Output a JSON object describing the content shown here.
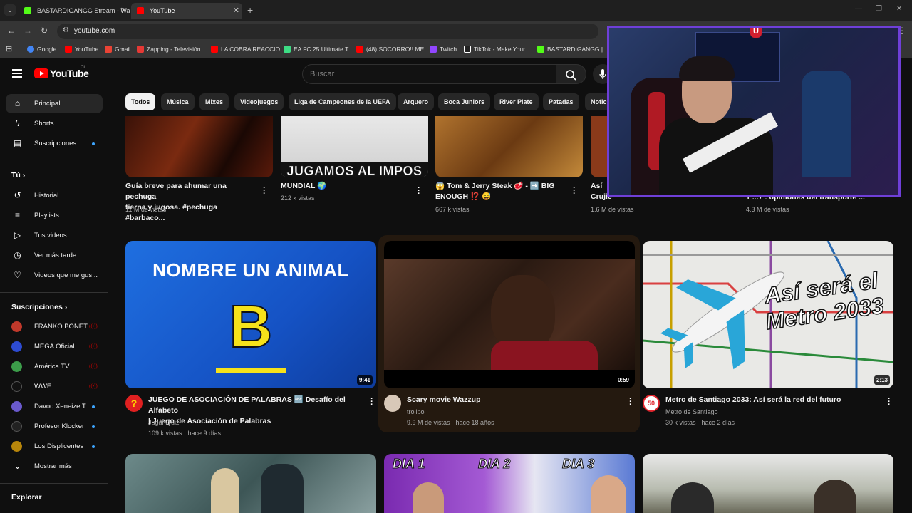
{
  "browser": {
    "tabs": [
      {
        "title": "BASTARDIGANGG Stream - Wa",
        "active": false,
        "favicon_color": "#53fc18"
      },
      {
        "title": "YouTube",
        "active": true,
        "favicon_color": "#ff0000"
      }
    ],
    "url": "youtube.com",
    "bookmarks": [
      {
        "label": "Google",
        "color": "#4285f4"
      },
      {
        "label": "YouTube",
        "color": "#ff0000"
      },
      {
        "label": "Gmail",
        "color": "#ea4335"
      },
      {
        "label": "Zapping - Televisión...",
        "color": "#e53935"
      },
      {
        "label": "LA COBRA REACCIO...",
        "color": "#ff0000"
      },
      {
        "label": "EA FC 25 Ultimate T...",
        "color": "#3ddc84"
      },
      {
        "label": "(48) SOCORRO!! ME...",
        "color": "#ff0000"
      },
      {
        "label": "Twitch",
        "color": "#9146ff"
      },
      {
        "label": "TikTok - Make Your...",
        "color": "#ffffff"
      },
      {
        "label": "BASTARDIGANGG |...",
        "color": "#53fc18"
      }
    ]
  },
  "header": {
    "logo_text": "YouTube",
    "country": "CL",
    "search_placeholder": "Buscar"
  },
  "sidebar": {
    "main": [
      {
        "label": "Principal",
        "icon": "home-icon",
        "glyph": "⌂",
        "active": true
      },
      {
        "label": "Shorts",
        "icon": "shorts-icon",
        "glyph": "ϟ"
      },
      {
        "label": "Suscripciones",
        "icon": "subscriptions-icon",
        "glyph": "▤",
        "dot": true
      }
    ],
    "you_header": "Tú",
    "you": [
      {
        "label": "Historial",
        "icon": "history-icon",
        "glyph": "↺"
      },
      {
        "label": "Playlists",
        "icon": "playlists-icon",
        "glyph": "≡"
      },
      {
        "label": "Tus videos",
        "icon": "your-videos-icon",
        "glyph": "▷"
      },
      {
        "label": "Ver más tarde",
        "icon": "watch-later-icon",
        "glyph": "◷"
      },
      {
        "label": "Videos que me gus...",
        "icon": "liked-icon",
        "glyph": "♡"
      }
    ],
    "subs_header": "Suscripciones",
    "subs": [
      {
        "label": "FRANKO BONET...",
        "color": "#c0392b",
        "live": true
      },
      {
        "label": "MEGA Oficial",
        "color": "#2d4bd1",
        "live": true
      },
      {
        "label": "América TV",
        "color": "#3c9d4a",
        "live": true
      },
      {
        "label": "WWE",
        "color": "#111111",
        "live": true
      },
      {
        "label": "Davoo Xeneize T...",
        "color": "#6a5acd",
        "dot": true
      },
      {
        "label": "Profesor Klocker",
        "color": "#222222",
        "dot": true
      },
      {
        "label": "Los Displicentes",
        "color": "#b8860b",
        "dot": true
      }
    ],
    "show_more": "Mostrar más",
    "explore_header": "Explorar"
  },
  "chips": [
    "Todos",
    "Música",
    "Mixes",
    "Videojuegos",
    "Liga de Campeones de la UEFA",
    "Arquero",
    "Boca Juniors",
    "River Plate",
    "Patadas",
    "Notici"
  ],
  "top_row": [
    {
      "title_l1": "Guía breve para ahumar una pechuga",
      "title_l2": "tierna y jugosa. #pechuga #barbaco...",
      "meta": "11 M de vistas"
    },
    {
      "title_l1": "MUNDIAL 🌍",
      "title_l2": "",
      "meta": "212 k vistas",
      "overlay": "JUGAMOS AL IMPOS"
    },
    {
      "title_l1": "😱 Tom & Jerry Steak 🥩 - ➡️ BIG",
      "title_l2": "ENOUGH ⁉️ 😅",
      "meta": "667 k vistas"
    },
    {
      "title_l1": "Así",
      "title_l2": "Crujiente",
      "meta": "1.6 M de vistas"
    },
    {
      "title_l1": "",
      "title_l2": "1 ...7 : opiniones del transporte ...",
      "meta": "4.3 M de vistas"
    }
  ],
  "videos": [
    {
      "title_l1": "JUEGO DE ASOCIACIÓN DE PALABRAS 🔤 Desafío del Alfabeto",
      "title_l2": "| Juego de Asociación de Palabras",
      "channel": "Jugar Quiz",
      "meta": "109 k vistas · hace 9 días",
      "duration": "9:41",
      "thumb_text": "NOMBRE UN ANIMAL",
      "thumb_letter": "B"
    },
    {
      "title_l1": "Scary movie Wazzup",
      "title_l2": "",
      "channel": "trolipo",
      "meta": "9.9 M de vistas · hace 18 años",
      "duration": "0:59"
    },
    {
      "title_l1": "Metro de Santiago 2033: Así será la red del futuro",
      "title_l2": "",
      "channel": "Metro de Santiago",
      "meta": "30 k vistas · hace 2 días",
      "duration": "2:13",
      "thumb_text_l1": "Así será el",
      "thumb_text_l2": "Metro 2033"
    }
  ],
  "bottom_row": [
    {
      "labels": []
    },
    {
      "labels": [
        "DIA 1",
        "DIA 2",
        "DIA 3"
      ]
    },
    {
      "labels": []
    }
  ],
  "colors": {
    "accent": "#ff0000",
    "bg": "#0f0f0f",
    "chip": "#272727",
    "webcam_border": "#6f3fd8"
  }
}
